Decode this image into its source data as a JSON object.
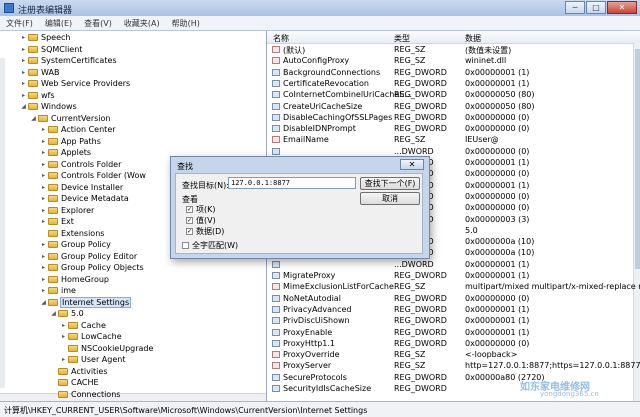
{
  "window": {
    "title": "注册表编辑器",
    "buttons": {
      "minimize": "─",
      "maximize": "□",
      "close": "✕"
    }
  },
  "menu": [
    "文件(F)",
    "编辑(E)",
    "查看(V)",
    "收藏夹(A)",
    "帮助(H)"
  ],
  "tree": [
    {
      "label": "Speech",
      "indent": 1,
      "expander": "▸"
    },
    {
      "label": "SQMClient",
      "indent": 1,
      "expander": "▸"
    },
    {
      "label": "SystemCertificates",
      "indent": 1,
      "expander": "▸"
    },
    {
      "label": "WAB",
      "indent": 1,
      "expander": "▸"
    },
    {
      "label": "Web Service Providers",
      "indent": 1,
      "expander": "▸"
    },
    {
      "label": "wfs",
      "indent": 1,
      "expander": "▸"
    },
    {
      "label": "Windows",
      "indent": 1,
      "expander": "◢"
    },
    {
      "label": "CurrentVersion",
      "indent": 2,
      "expander": "◢"
    },
    {
      "label": "Action Center",
      "indent": 3,
      "expander": "▸"
    },
    {
      "label": "App Paths",
      "indent": 3,
      "expander": "▸"
    },
    {
      "label": "Applets",
      "indent": 3,
      "expander": "▸"
    },
    {
      "label": "Controls Folder",
      "indent": 3,
      "expander": "▸"
    },
    {
      "label": "Controls Folder (Wow",
      "indent": 3,
      "expander": "▸"
    },
    {
      "label": "Device Installer",
      "indent": 3,
      "expander": "▸"
    },
    {
      "label": "Device Metadata",
      "indent": 3,
      "expander": "▸"
    },
    {
      "label": "Explorer",
      "indent": 3,
      "expander": "▸"
    },
    {
      "label": "Ext",
      "indent": 3,
      "expander": "▸"
    },
    {
      "label": "Extensions",
      "indent": 3,
      "expander": ""
    },
    {
      "label": "Group Policy",
      "indent": 3,
      "expander": "▸"
    },
    {
      "label": "Group Policy Editor",
      "indent": 3,
      "expander": "▸"
    },
    {
      "label": "Group Policy Objects",
      "indent": 3,
      "expander": "▸"
    },
    {
      "label": "HomeGroup",
      "indent": 3,
      "expander": "▸"
    },
    {
      "label": "ime",
      "indent": 3,
      "expander": "▸"
    },
    {
      "label": "Internet Settings",
      "indent": 3,
      "expander": "◢",
      "selected": true
    },
    {
      "label": "5.0",
      "indent": 4,
      "expander": "◢"
    },
    {
      "label": "Cache",
      "indent": 5,
      "expander": "▸"
    },
    {
      "label": "LowCache",
      "indent": 5,
      "expander": "▸"
    },
    {
      "label": "NSCookieUpgrade",
      "indent": 5,
      "expander": ""
    },
    {
      "label": "User Agent",
      "indent": 5,
      "expander": "▸"
    },
    {
      "label": "Activities",
      "indent": 4,
      "expander": ""
    },
    {
      "label": "CACHE",
      "indent": 4,
      "expander": ""
    },
    {
      "label": "Connections",
      "indent": 4,
      "expander": ""
    }
  ],
  "values_header": {
    "name": "名称",
    "type": "类型",
    "data": "数据"
  },
  "values": [
    {
      "name": "(默认)",
      "type": "REG_SZ",
      "data": "(数值未设置)",
      "kind": "sz"
    },
    {
      "name": "AutoConfigProxy",
      "type": "REG_SZ",
      "data": "wininet.dll",
      "kind": "sz"
    },
    {
      "name": "BackgroundConnections",
      "type": "REG_DWORD",
      "data": "0x00000001 (1)",
      "kind": "dw"
    },
    {
      "name": "CertificateRevocation",
      "type": "REG_DWORD",
      "data": "0x00000001 (1)",
      "kind": "dw"
    },
    {
      "name": "CoInternetCombinelUriCacheS...",
      "type": "REG_DWORD",
      "data": "0x00000050 (80)",
      "kind": "dw"
    },
    {
      "name": "CreateUriCacheSize",
      "type": "REG_DWORD",
      "data": "0x00000050 (80)",
      "kind": "dw"
    },
    {
      "name": "DisableCachingOfSSLPages",
      "type": "REG_DWORD",
      "data": "0x00000000 (0)",
      "kind": "dw"
    },
    {
      "name": "DisableIDNPrompt",
      "type": "REG_DWORD",
      "data": "0x00000000 (0)",
      "kind": "dw"
    },
    {
      "name": "EmailName",
      "type": "REG_SZ",
      "data": "IEUser@",
      "kind": "sz"
    },
    {
      "name": "",
      "type": "...DWORD",
      "data": "0x00000000 (0)",
      "kind": "dw"
    },
    {
      "name": "",
      "type": "...DWORD",
      "data": "0x00000001 (1)",
      "kind": "dw"
    },
    {
      "name": "",
      "type": "...DWORD",
      "data": "0x00000000 (0)",
      "kind": "dw"
    },
    {
      "name": "",
      "type": "...DWORD",
      "data": "0x00000001 (1)",
      "kind": "dw"
    },
    {
      "name": "",
      "type": "...DWORD",
      "data": "0x00000000 (0)",
      "kind": "dw"
    },
    {
      "name": "",
      "type": "...DWORD",
      "data": "0x00000000 (0)",
      "kind": "dw"
    },
    {
      "name": "",
      "type": "...DWORD",
      "data": "0x00000003 (3)",
      "kind": "dw"
    },
    {
      "name": "",
      "type": "...SZ",
      "data": "5.0",
      "kind": "sz"
    },
    {
      "name": "",
      "type": "...DWORD",
      "data": "0x0000000a (10)",
      "kind": "dw"
    },
    {
      "name": "",
      "type": "...DWORD",
      "data": "0x0000000a (10)",
      "kind": "dw"
    },
    {
      "name": "",
      "type": "...DWORD",
      "data": "0x00000001 (1)",
      "kind": "dw"
    },
    {
      "name": "MigrateProxy",
      "type": "REG_DWORD",
      "data": "0x00000001 (1)",
      "kind": "dw"
    },
    {
      "name": "MimeExclusionListForCache",
      "type": "REG_SZ",
      "data": "multipart/mixed multipart/x-mixed-replace m...",
      "kind": "sz"
    },
    {
      "name": "NoNetAutodial",
      "type": "REG_DWORD",
      "data": "0x00000000 (0)",
      "kind": "dw"
    },
    {
      "name": "PrivacyAdvanced",
      "type": "REG_DWORD",
      "data": "0x00000001 (1)",
      "kind": "dw"
    },
    {
      "name": "PrivDiscUiShown",
      "type": "REG_DWORD",
      "data": "0x00000001 (1)",
      "kind": "dw"
    },
    {
      "name": "ProxyEnable",
      "type": "REG_DWORD",
      "data": "0x00000001 (1)",
      "kind": "dw"
    },
    {
      "name": "ProxyHttp1.1",
      "type": "REG_DWORD",
      "data": "0x00000000 (0)",
      "kind": "dw"
    },
    {
      "name": "ProxyOverride",
      "type": "REG_SZ",
      "data": "<-loopback>",
      "kind": "sz"
    },
    {
      "name": "ProxyServer",
      "type": "REG_SZ",
      "data": "http=127.0.0.1:8877;https=127.0.0.1:8877",
      "kind": "sz"
    },
    {
      "name": "SecureProtocols",
      "type": "REG_DWORD",
      "data": "0x00000a80 (2720)",
      "kind": "dw"
    },
    {
      "name": "SecurityIdIsCacheSize",
      "type": "REG_DWORD",
      "data": "",
      "kind": "dw"
    }
  ],
  "find_dialog": {
    "title": "查找",
    "close": "✕",
    "find_label": "查找目标(N):",
    "find_value": "127.0.0.1:8877",
    "find_next": "查找下一个(F)",
    "cancel": "取消",
    "look_at": "查看",
    "options": [
      {
        "label": "项(K)",
        "checked": "✓"
      },
      {
        "label": "值(V)",
        "checked": "✓"
      },
      {
        "label": "数据(D)",
        "checked": "✓"
      }
    ],
    "match_whole": {
      "label": "全字匹配(W)",
      "checked": ""
    }
  },
  "status": "计算机\\HKEY_CURRENT_USER\\Software\\Microsoft\\Windows\\CurrentVersion\\Internet Settings",
  "watermark": {
    "text": "如东家电维修网",
    "sub": "yongdong365.cn"
  }
}
